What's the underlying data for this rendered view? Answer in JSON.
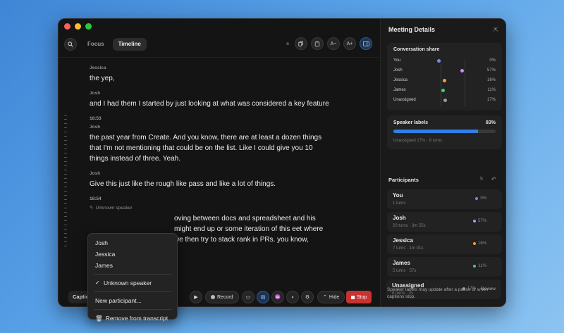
{
  "toolbar": {
    "tabs": [
      {
        "label": "Focus",
        "active": false
      },
      {
        "label": "Timeline",
        "active": true
      }
    ],
    "font_decrease": "A−",
    "font_increase": "A+"
  },
  "transcript": {
    "entries": [
      {
        "type": "speaker",
        "text": "Jessica"
      },
      {
        "type": "line",
        "text": "the yep,"
      },
      {
        "type": "speaker",
        "text": "Josh"
      },
      {
        "type": "line",
        "text": "and I had them I started by just looking at what was considered a key feature"
      },
      {
        "type": "ts",
        "text": "18:53"
      },
      {
        "type": "speaker",
        "text": "Josh"
      },
      {
        "type": "line",
        "text": "the past year from Create. And you know, there are at least a dozen things that I'm not mentioning that could be on the list. Like I could give you 10 things instead of three. Yeah."
      },
      {
        "type": "speaker",
        "text": "Josh"
      },
      {
        "type": "line",
        "text": "Give this just like the rough like pass and like a lot of things."
      },
      {
        "type": "ts",
        "text": "18:54"
      },
      {
        "type": "unknown",
        "text": "Unknown speaker"
      },
      {
        "type": "line",
        "text": "oving between docs and spreadsheet and his might end up or some iteration of this eet where we then try to stack rank in PRs. you know,"
      }
    ]
  },
  "menu": {
    "people": [
      "Josh",
      "Jessica",
      "James"
    ],
    "unknown": "Unknown speaker",
    "new_participant": "New participant...",
    "remove": "Remove from transcript"
  },
  "bottom": {
    "caption": "Captio",
    "record": "Record",
    "hide": "Hide",
    "stop": "Stop"
  },
  "sidebar": {
    "title": "Meeting Details",
    "share": {
      "title": "Conversation share",
      "rows": [
        {
          "name": "You",
          "pct": "0%",
          "value": 0,
          "color": "#7b86ff"
        },
        {
          "name": "Josh",
          "pct": "57%",
          "value": 57,
          "color": "#c58bff"
        },
        {
          "name": "Jessica",
          "pct": "16%",
          "value": 16,
          "color": "#ff9a3c"
        },
        {
          "name": "James",
          "pct": "11%",
          "value": 11,
          "color": "#3bd17a"
        },
        {
          "name": "Unassigned",
          "pct": "17%",
          "value": 17,
          "color": "#9a9a9a"
        }
      ]
    },
    "labels": {
      "title": "Speaker labels",
      "pct": "83%",
      "value": 83,
      "sub": "Unassigned 17% · 8 turns"
    },
    "participants": {
      "title": "Participants",
      "count": "5",
      "items": [
        {
          "name": "You",
          "meta": "1 turns",
          "pct": "0%",
          "color": "#7b86ff"
        },
        {
          "name": "Josh",
          "meta": "20 turns · 3m 55s",
          "pct": "57%",
          "color": "#c58bff"
        },
        {
          "name": "Jessica",
          "meta": "7 turns · 1m 01s",
          "pct": "16%",
          "color": "#ff9a3c"
        },
        {
          "name": "James",
          "meta": "5 turns · 57s",
          "pct": "11%",
          "color": "#3bd17a"
        },
        {
          "name": "Unassigned",
          "meta": "8 turns · 2s",
          "pct": "17%",
          "color": "#9a9a9a",
          "action": "Review"
        }
      ]
    },
    "note": "Speaker labels may update after a pause or when captions stop."
  }
}
